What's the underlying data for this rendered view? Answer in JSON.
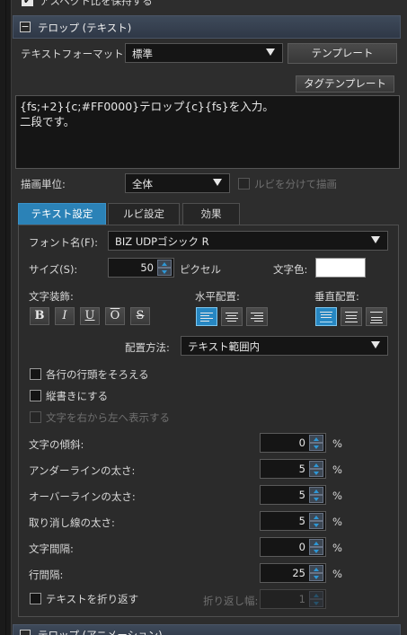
{
  "top_cut_checkbox_label": "アスペクト比を保持する",
  "section": {
    "title": "テロップ (テキスト)",
    "collapse_symbol": "−"
  },
  "format": {
    "label": "テキストフォーマット:",
    "value": "標準",
    "template_button": "テンプレート",
    "tag_template_button": "タグテンプレート"
  },
  "text_input": {
    "value": "{fs;+2}{c;#FF0000}テロップ{c}{fs}を入力。\n二段です。"
  },
  "draw_unit": {
    "label": "描画単位:",
    "value": "全体",
    "ruby_checkbox_label": "ルビを分けて描画"
  },
  "tabs": [
    {
      "label": "テキスト設定",
      "active": true
    },
    {
      "label": "ルビ設定",
      "active": false
    },
    {
      "label": "効果",
      "active": false
    }
  ],
  "font": {
    "label": "フォント名(F):",
    "value": "BIZ UDPゴシック R"
  },
  "size": {
    "label": "サイズ(S):",
    "value": "50",
    "unit": "ピクセル"
  },
  "text_color": {
    "label": "文字色:",
    "color": "#ffffff"
  },
  "decoration": {
    "label": "文字装飾:",
    "buttons": [
      {
        "glyph": "B",
        "name": "bold"
      },
      {
        "glyph": "I",
        "name": "italic"
      },
      {
        "glyph": "U",
        "name": "underline"
      },
      {
        "glyph": "O",
        "name": "overline"
      },
      {
        "glyph": "S",
        "name": "strikethrough"
      }
    ]
  },
  "h_align": {
    "label": "水平配置:",
    "options": [
      "left",
      "center",
      "right"
    ],
    "selected": "left"
  },
  "v_align": {
    "label": "垂直配置:",
    "options": [
      "top",
      "middle",
      "bottom"
    ],
    "selected": "top"
  },
  "placement": {
    "label": "配置方法:",
    "value": "テキスト範囲内"
  },
  "options": {
    "align_line_heads": "各行の行頭をそろえる",
    "vertical_writing": "縦書きにする",
    "rtl_display": "文字を右から左へ表示する"
  },
  "fields": [
    {
      "label": "文字の傾斜:",
      "value": "0",
      "unit": "%"
    },
    {
      "label": "アンダーラインの太さ:",
      "value": "5",
      "unit": "%"
    },
    {
      "label": "オーバーラインの太さ:",
      "value": "5",
      "unit": "%"
    },
    {
      "label": "取り消し線の太さ:",
      "value": "5",
      "unit": "%"
    },
    {
      "label": "文字間隔:",
      "value": "0",
      "unit": "%"
    },
    {
      "label": "行間隔:",
      "value": "25",
      "unit": "%"
    }
  ],
  "wrap": {
    "checkbox_label": "テキストを折り返す",
    "width_label": "折り返し幅:",
    "width_value": "1"
  },
  "next_section_title": "テロップ (アニメーション)",
  "colors": {
    "accent": "#2b82b7",
    "panel_bg": "#2d2d2d",
    "input_bg": "#151515"
  }
}
